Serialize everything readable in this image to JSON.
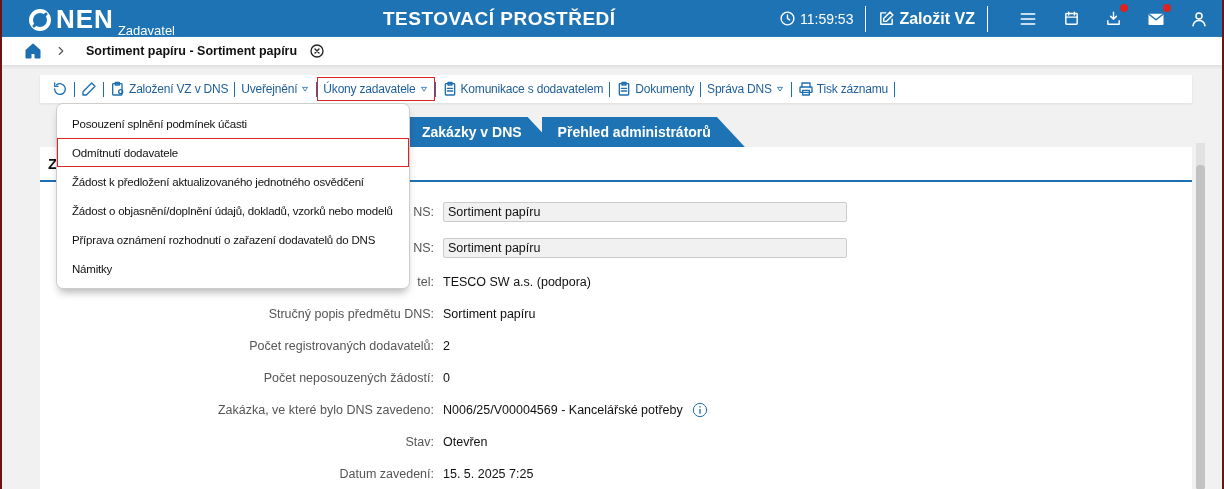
{
  "header": {
    "logo": "NEN",
    "role": "Zadavatel",
    "title": "TESTOVACÍ PROSTŘEDÍ",
    "time": "11:59:53",
    "create_button": "Založit VZ",
    "download_badge": true,
    "mail_badge": true
  },
  "breadcrumb": {
    "title": "Sortiment papíru - Sortiment papíru"
  },
  "toolbar": [
    {
      "kind": "icon"
    },
    {
      "kind": "icon"
    },
    {
      "kind": "action",
      "label": "Založení VZ v DNS",
      "selected": false
    },
    {
      "kind": "action",
      "label": "Uveřejnění",
      "dropdown": true,
      "selected": false
    },
    {
      "kind": "action",
      "label": "Úkony zadavatele",
      "dropdown": true,
      "selected": true
    },
    {
      "kind": "action",
      "label": "Komunikace s dodavatelem",
      "selected": false
    },
    {
      "kind": "action",
      "label": "Dokumenty",
      "selected": false
    },
    {
      "kind": "action",
      "label": "Správa DNS",
      "dropdown": true,
      "selected": false
    },
    {
      "kind": "action",
      "label": "Tisk záznamu",
      "selected": false
    }
  ],
  "menu": [
    {
      "label": "Posouzení splnění podmínek účasti",
      "selected": false
    },
    {
      "label": "Odmítnutí dodavatele",
      "selected": true
    },
    {
      "label": "Žádost k předložení aktualizovaného jednotného osvědčení",
      "selected": false
    },
    {
      "label": "Žádost o objasnění/doplnění údajů, dokladů, vzorků nebo modelů",
      "selected": false
    },
    {
      "label": "Příprava oznámení rozhodnutí o zařazení dodavatelů do DNS",
      "selected": false
    },
    {
      "label": "Námitky",
      "selected": false
    }
  ],
  "tabs": [
    {
      "label": "Zakázky v DNS",
      "selected": false
    },
    {
      "label": "Přehled administrátorů",
      "selected": false
    }
  ],
  "panel": {
    "title": "Z"
  },
  "rows": [
    {
      "label": "NS:",
      "value": "Sortiment papíru",
      "kind": "field"
    },
    {
      "label": "NS:",
      "value": "Sortiment papíru",
      "kind": "field"
    },
    {
      "label": "tel:",
      "value": "TESCO SW a.s. (podpora)",
      "kind": "text"
    },
    {
      "label": "Stručný popis předmětu DNS:",
      "value": "Sortiment papíru",
      "kind": "text"
    },
    {
      "label": "Počet registrovaných dodavatelů:",
      "value": "2",
      "kind": "text"
    },
    {
      "label": "Počet neposouzených žádostí:",
      "value": "0",
      "kind": "text"
    },
    {
      "label": "Zakázka, ve které bylo DNS zavedeno:",
      "value": "N006/25/V00004569 - Kancelářské potřeby",
      "kind": "text",
      "info": true
    },
    {
      "label": "Stav:",
      "value": "Otevřen",
      "kind": "text"
    },
    {
      "label": "Datum zavedení:",
      "value": "15. 5. 2025 7:25",
      "kind": "text"
    }
  ]
}
